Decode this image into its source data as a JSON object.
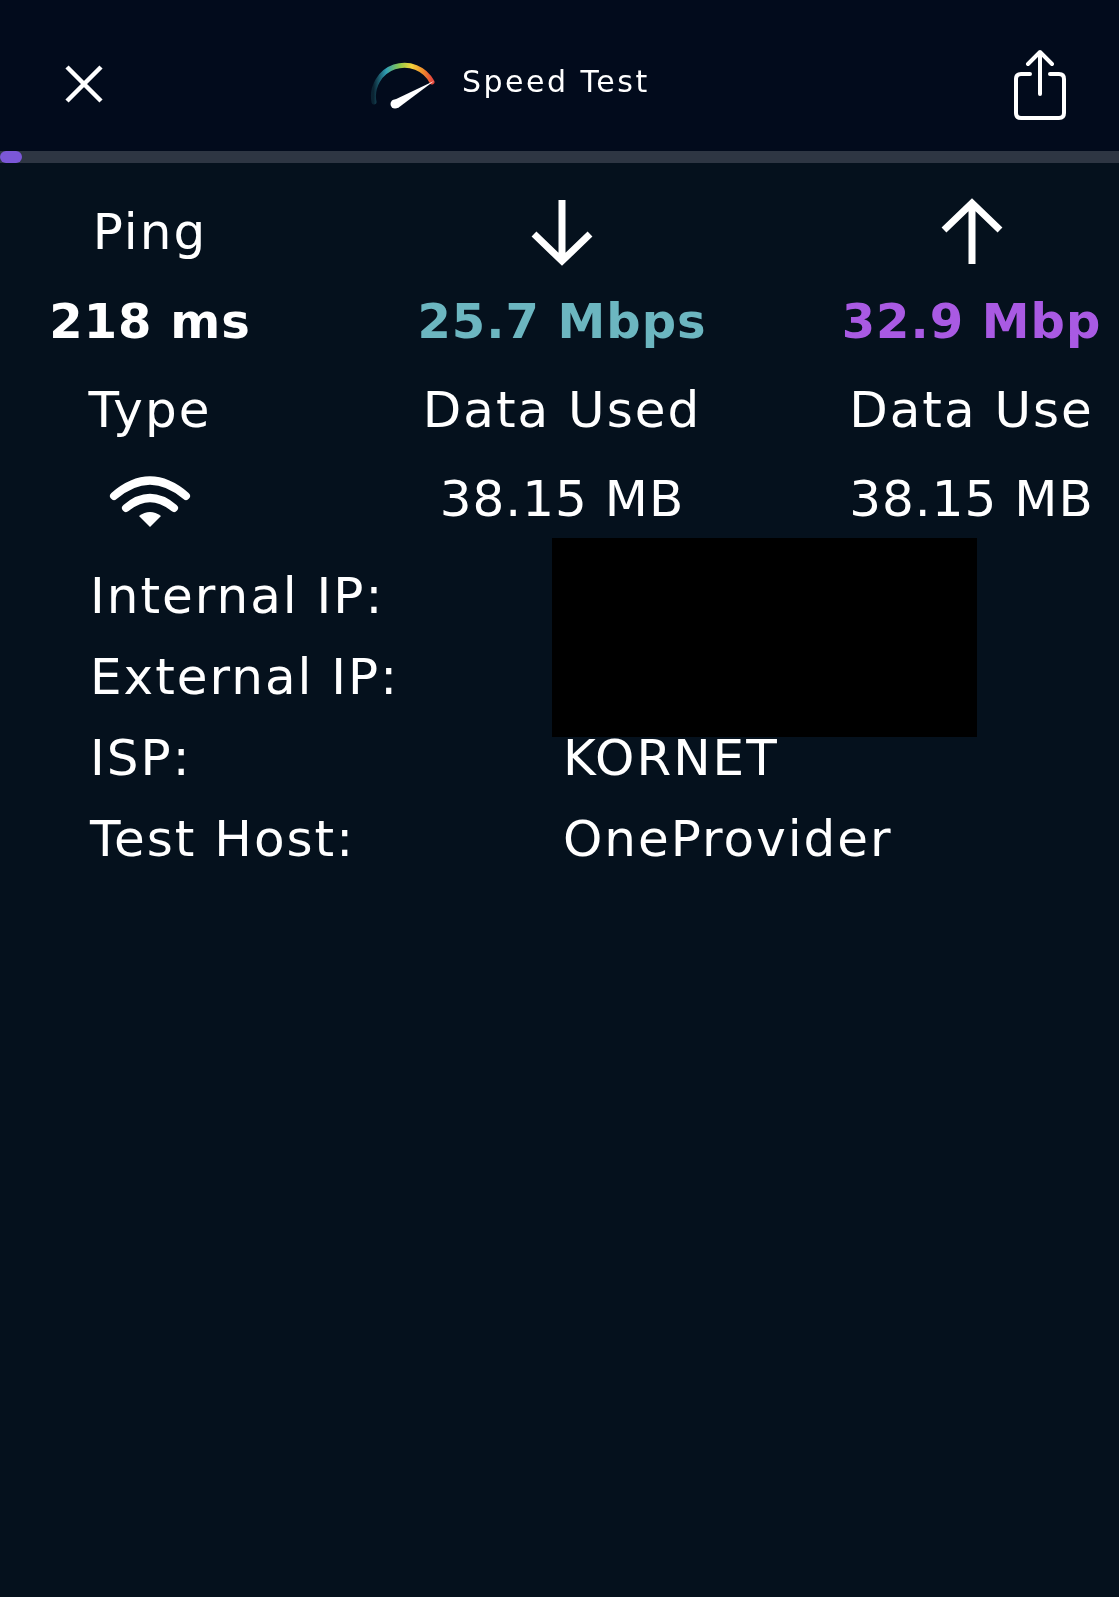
{
  "header": {
    "title": "Speed Test",
    "progress": {
      "level": 0.02
    }
  },
  "results": [
    {
      "kind": "ping",
      "label": "Ping",
      "value": "218 ms",
      "color": "#ffffff",
      "detail_label": "Type"
    },
    {
      "kind": "download",
      "value": "25.7 Mbps",
      "color": "#6cb6c0",
      "detail_label": "Data Used",
      "detail_value": "38.15 MB"
    },
    {
      "kind": "upload",
      "value": "32.9 Mbp",
      "color": "#a95ae3",
      "detail_label": "Data Use",
      "detail_value": "38.15 MB"
    }
  ],
  "info": [
    {
      "label": "Internal IP:",
      "redacted": true
    },
    {
      "label": "External IP:",
      "redacted": true
    },
    {
      "label": "ISP:",
      "value": "KORNET",
      "redacted": false
    },
    {
      "label": "Test Host:",
      "value": "OneProvider",
      "redacted": false
    }
  ]
}
